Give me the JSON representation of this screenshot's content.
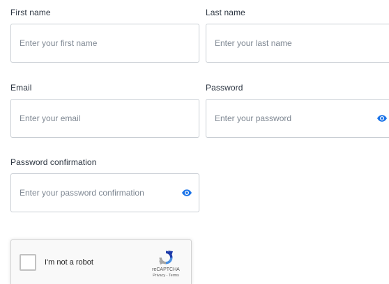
{
  "form": {
    "first_name": {
      "label": "First name",
      "value": "",
      "placeholder": "Enter your first name"
    },
    "last_name": {
      "label": "Last name",
      "value": "",
      "placeholder": "Enter your last name"
    },
    "email": {
      "label": "Email",
      "value": "",
      "placeholder": "Enter your email"
    },
    "password": {
      "label": "Password",
      "value": "",
      "placeholder": "Enter your password",
      "toggle_icon": "eye-icon"
    },
    "password_confirmation": {
      "label": "Password confirmation",
      "value": "",
      "placeholder": "Enter your password confirmation",
      "toggle_icon": "eye-icon"
    }
  },
  "recaptcha": {
    "checkbox_label": "I'm not a robot",
    "checked": false,
    "brand": "reCAPTCHA",
    "privacy_label": "Privacy",
    "separator": " - ",
    "terms_label": "Terms",
    "logo_icon": "recaptcha-logo-icon"
  },
  "colors": {
    "accent": "#1a73e8",
    "label_text": "#2b3440",
    "placeholder_text": "#7f8893",
    "input_border": "#c9ced4",
    "recaptcha_bg": "#f9f9f9",
    "recaptcha_border": "#d3d3d3"
  }
}
